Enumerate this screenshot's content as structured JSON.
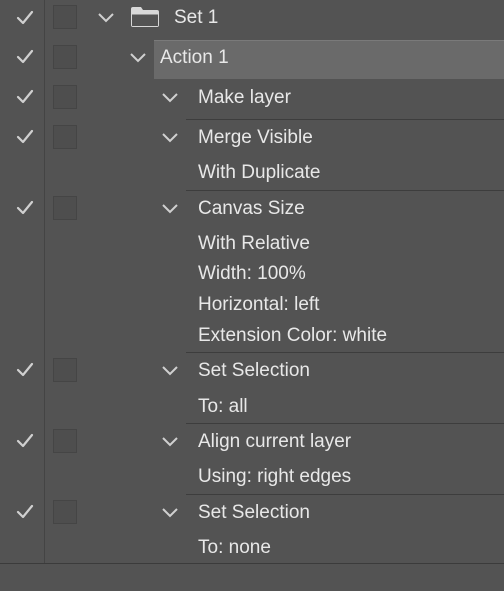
{
  "actions_panel": {
    "set": {
      "label": "Set 1"
    },
    "action": {
      "label": "Action 1"
    },
    "steps": [
      {
        "title": "Make layer",
        "details": []
      },
      {
        "title": "Merge Visible",
        "details": [
          "With Duplicate"
        ]
      },
      {
        "title": "Canvas Size",
        "details": [
          "With Relative",
          "Width: 100%",
          "Horizontal: left",
          "Extension Color: white"
        ]
      },
      {
        "title": "Set Selection",
        "details": [
          "To: all"
        ]
      },
      {
        "title": "Align current layer",
        "details": [
          "Using: right edges"
        ]
      },
      {
        "title": "Set Selection",
        "details": [
          "To: none"
        ]
      }
    ]
  }
}
